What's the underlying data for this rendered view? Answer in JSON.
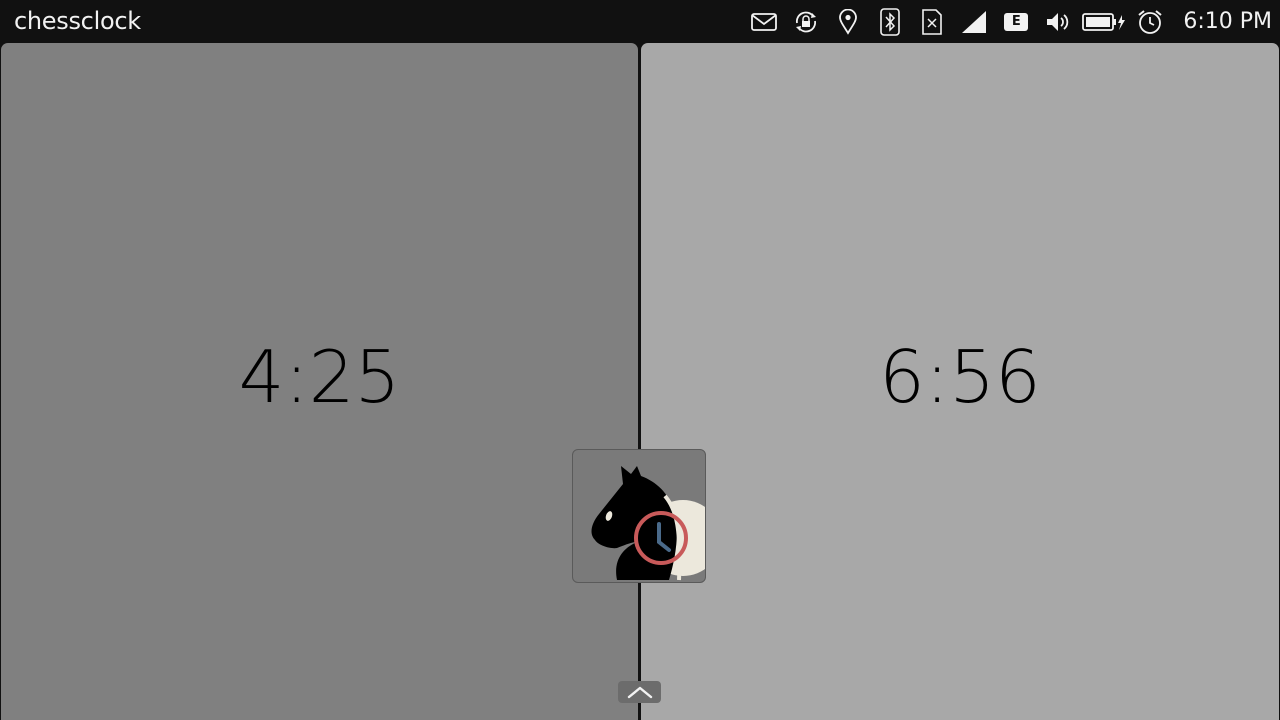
{
  "app": {
    "title": "chessclock"
  },
  "statusbar": {
    "indicators": [
      "mail-icon",
      "rotation-lock-icon",
      "location-icon",
      "bluetooth-icon",
      "no-sim-icon",
      "signal-icon",
      "network-edge-icon",
      "volume-icon",
      "battery-charging-icon",
      "alarm-icon"
    ],
    "network_type": "E",
    "time": "6:10 PM"
  },
  "players": {
    "left": {
      "time": "4:25",
      "color": "#808080"
    },
    "right": {
      "time": "6:56",
      "color": "#a8a8a8"
    }
  },
  "app_icon": {
    "name": "chess-knight-clock-icon"
  },
  "bottom_edge": {
    "icon": "chevron-up-icon"
  }
}
